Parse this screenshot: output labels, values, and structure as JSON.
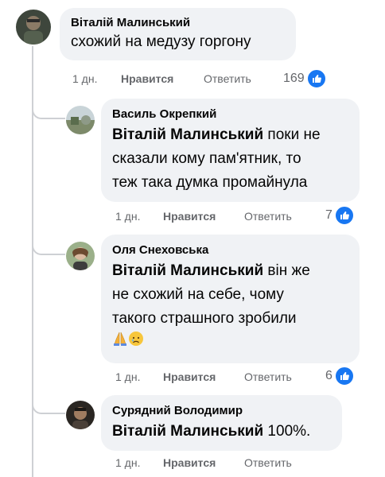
{
  "comments": [
    {
      "author": "Віталій Малинський",
      "mention": "",
      "text": "схожий на медузу горгону",
      "time": "1 дн.",
      "like_label": "Нравится",
      "reply_label": "Ответить",
      "reactions": "169"
    },
    {
      "author": "Василь Окрепкий",
      "mention": "Віталій Малинський",
      "line1_rest": " поки не",
      "line2": "сказали кому пам'ятник, то",
      "line3": "теж така думка промайнула",
      "time": "1 дн.",
      "like_label": "Нравится",
      "reply_label": "Ответить",
      "reactions": "7"
    },
    {
      "author": "Оля Снеховська",
      "mention": "Віталій Малинський",
      "line1_rest": " він же",
      "line2": "не схожий на себе, чому",
      "line3": "такого страшного зробили",
      "emojis": [
        "praying-hands",
        "disappointed-face"
      ],
      "time": "1 дн.",
      "like_label": "Нравится",
      "reply_label": "Ответить",
      "reactions": "6"
    },
    {
      "author": "Сурядний Володимир",
      "mention": "Віталій Малинський",
      "line1_rest": " 100%.",
      "time": "1 дн.",
      "like_label": "Нравится",
      "reply_label": "Ответить"
    }
  ],
  "icons": {
    "like": "thumbs-up-icon"
  },
  "colors": {
    "bubble": "#f0f2f5",
    "meta_text": "#65676b",
    "like_blue": "#1877f2",
    "thread_line": "#ced0d4"
  }
}
